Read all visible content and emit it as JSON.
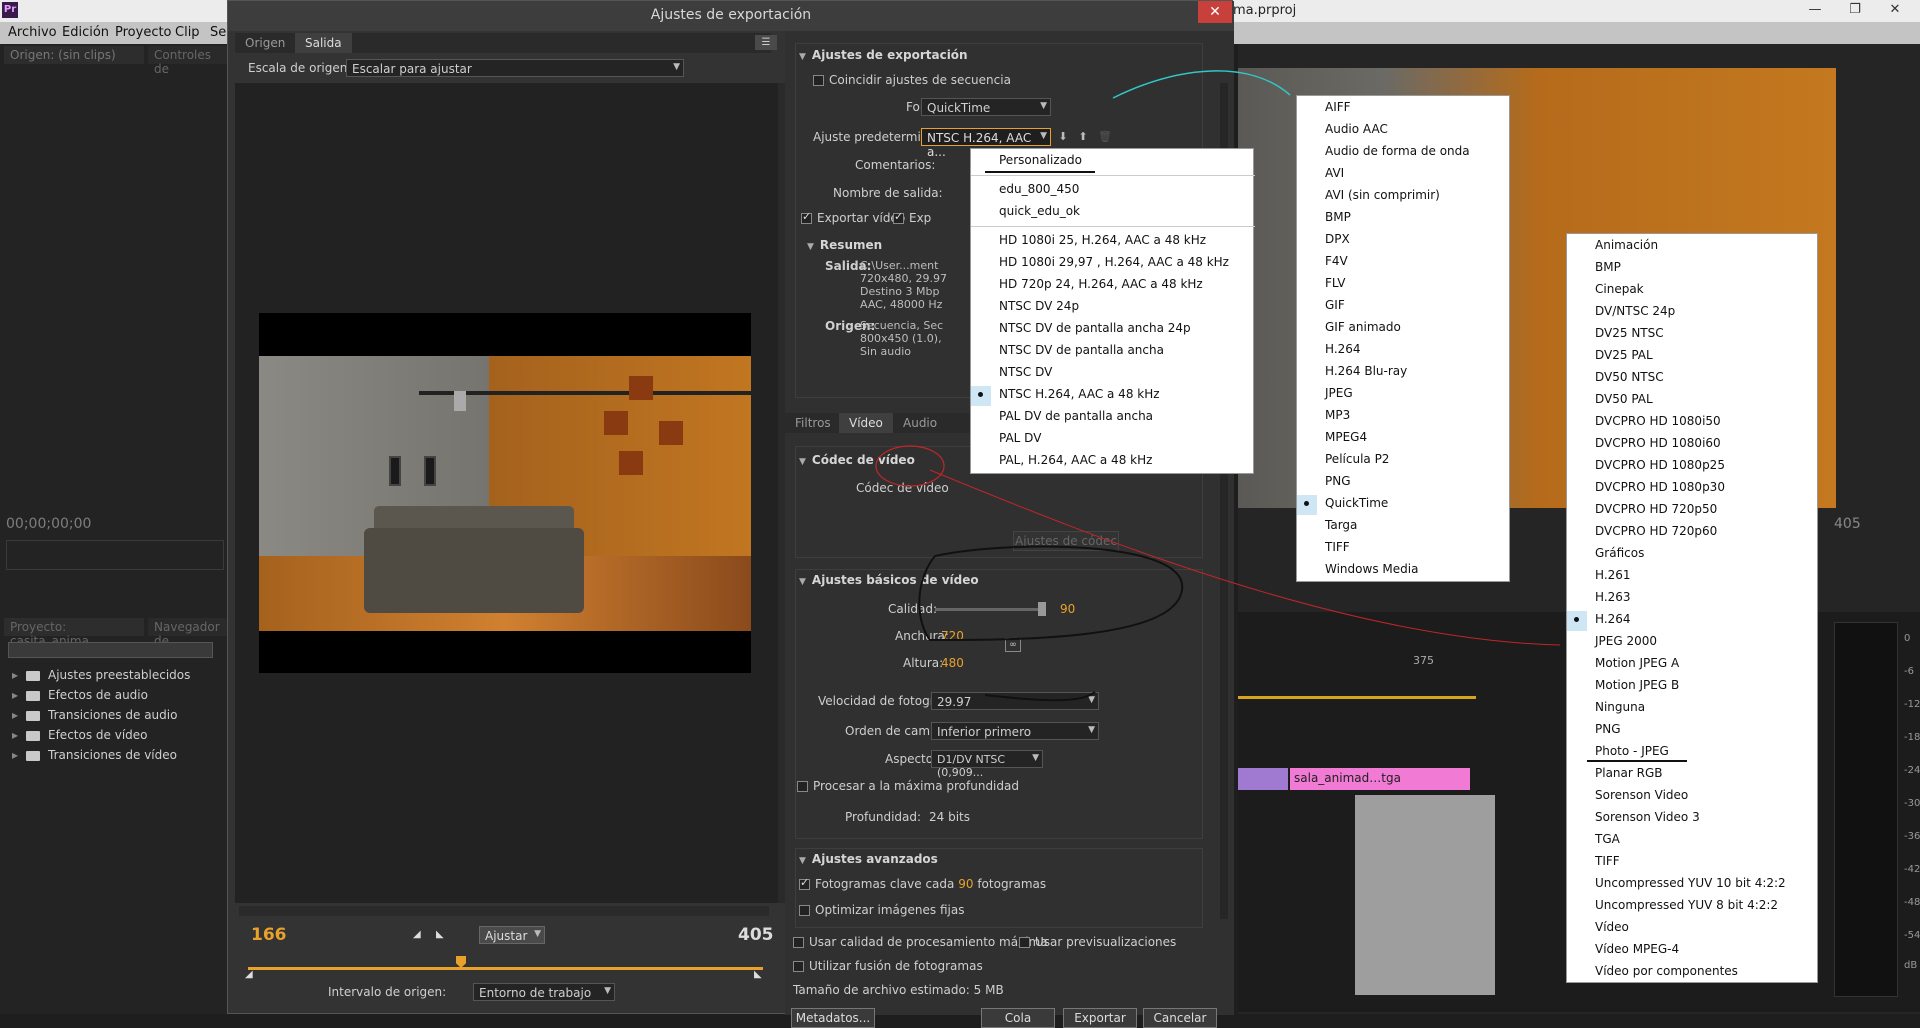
{
  "app": {
    "project_title": "ma.prproj",
    "menu": [
      "Archivo",
      "Edición",
      "Proyecto",
      "Clip",
      "Se"
    ],
    "source_tab": "Origen: (sin clips)",
    "controls_tab": "Controles de",
    "timecode": "00;00;00;00",
    "project_tab": "Proyecto: casita_anima",
    "navigator_tab": "Navegador de",
    "tree": [
      "Ajustes preestablecidos",
      "Efectos de audio",
      "Transiciones de audio",
      "Efectos de vídeo",
      "Transiciones de vídeo"
    ],
    "right_time": "405",
    "ruler_time": "375",
    "clip_name": "sala_animad…tga",
    "meter_db": [
      "0",
      "-6",
      "-12",
      "-18",
      "-24",
      "-30",
      "-36",
      "-42",
      "-48",
      "-54",
      "dB"
    ]
  },
  "dialog": {
    "title": "Ajustes de exportación",
    "close_glyph": "✕",
    "tabs": [
      "Origen",
      "Salida"
    ],
    "scale_label": "Escala de origen:",
    "scale_value": "Escalar para ajustar",
    "frame_start": "166",
    "frame_end": "405",
    "fit_value": "Ajustar",
    "range_label": "Intervalo de origen:",
    "range_value": "Entorno de trabajo"
  },
  "export": {
    "section_title": "Ajustes de exportación",
    "match_sequence": "Coincidir ajustes de secuencia",
    "format_label": "Formato:",
    "format_value": "QuickTime",
    "preset_label": "Ajuste predeterminado:",
    "preset_value": "NTSC H.264, AAC a...",
    "comments_label": "Comentarios:",
    "output_label": "Nombre de salida:",
    "export_video": "Exportar vídeo",
    "export_audio": "Exp",
    "summary_title": "Resumen",
    "output_key": "Salida:",
    "output_lines": [
      "C:\\User...ment",
      "720x480, 29.97",
      "Destino 3 Mbp",
      "AAC, 48000 Hz"
    ],
    "source_key": "Origen:",
    "source_lines": [
      "Secuencia, Sec",
      "800x450 (1.0),",
      "Sin audio"
    ]
  },
  "subtabs": [
    "Filtros",
    "Vídeo",
    "Audio"
  ],
  "codec": {
    "section_title": "Códec de vídeo",
    "codec_label": "Códec de vídeo",
    "codec_settings": "Ajustes de códec"
  },
  "basic": {
    "section_title": "Ajustes básicos de vídeo",
    "quality_label": "Calidad:",
    "quality_value": "90",
    "width_label": "Anchura:",
    "width_value": "720",
    "height_label": "Altura:",
    "height_value": "480",
    "framerate_label": "Velocidad de fotograma:",
    "framerate_value": "29.97",
    "field_label": "Orden de campos:",
    "field_value": "Inferior primero",
    "aspect_label": "Aspecto:",
    "aspect_value": "D1/DV NTSC (0,909...",
    "max_depth": "Procesar a la máxima profundidad",
    "depth_label": "Profundidad:",
    "depth_value": "24 bits"
  },
  "advanced": {
    "section_title": "Ajustes avanzados",
    "keyframe_prefix": "Fotogramas clave cada",
    "keyframe_value": "90",
    "keyframe_suffix": "fotogramas",
    "optimize_stills": "Optimizar imágenes fijas"
  },
  "footer": {
    "max_quality": "Usar calidad de procesamiento máxima",
    "use_previews": "Usar previsualizaciones",
    "frame_blend": "Utilizar fusión de fotogramas",
    "file_size": "Tamaño de archivo estimado:  5 MB",
    "metadata_btn": "Metadatos...",
    "queue_btn": "Cola",
    "export_btn": "Exportar",
    "cancel_btn": "Cancelar"
  },
  "preset_menu": {
    "items": [
      "Personalizado",
      "edu_800_450",
      "quick_edu_ok",
      "HD 1080i 25, H.264, AAC a 48 kHz",
      "HD 1080i 29,97 , H.264, AAC a 48 kHz",
      "HD 720p 24, H.264, AAC a 48 kHz",
      "NTSC DV 24p",
      "NTSC DV de pantalla ancha 24p",
      "NTSC DV de pantalla ancha",
      "NTSC DV",
      "NTSC H.264, AAC a 48 kHz",
      "PAL DV de pantalla ancha",
      "PAL DV",
      "PAL, H.264, AAC a 48 kHz"
    ],
    "selected_index": 10
  },
  "format_menu": {
    "items": [
      "AIFF",
      "Audio AAC",
      "Audio de forma de onda",
      "AVI",
      "AVI (sin comprimir)",
      "BMP",
      "DPX",
      "F4V",
      "FLV",
      "GIF",
      "GIF animado",
      "H.264",
      "H.264 Blu-ray",
      "JPEG",
      "MP3",
      "MPEG4",
      "Película P2",
      "PNG",
      "QuickTime",
      "Targa",
      "TIFF",
      "Windows Media"
    ],
    "selected_index": 18
  },
  "codec_menu": {
    "items": [
      "Animación",
      "BMP",
      "Cinepak",
      "DV/NTSC 24p",
      "DV25 NTSC",
      "DV25 PAL",
      "DV50 NTSC",
      "DV50 PAL",
      "DVCPRO HD 1080i50",
      "DVCPRO HD 1080i60",
      "DVCPRO HD 1080p25",
      "DVCPRO HD 1080p30",
      "DVCPRO HD 720p50",
      "DVCPRO HD 720p60",
      "Gráficos",
      "H.261",
      "H.263",
      "H.264",
      "JPEG 2000",
      "Motion JPEG A",
      "Motion JPEG B",
      "Ninguna",
      "PNG",
      "Photo - JPEG",
      "Planar RGB",
      "Sorenson Video",
      "Sorenson Video 3",
      "TGA",
      "TIFF",
      "Uncompressed YUV 10 bit 4:2:2",
      "Uncompressed YUV 8 bit 4:2:2",
      "Vídeo",
      "Vídeo MPEG-4",
      "Vídeo por componentes"
    ],
    "selected_index": 17
  },
  "colors": {
    "accent": "#e8a22b",
    "close_red": "#c7403b",
    "selected_gutter": "#cfe7f5",
    "clip_pink": "#f07ad4"
  }
}
